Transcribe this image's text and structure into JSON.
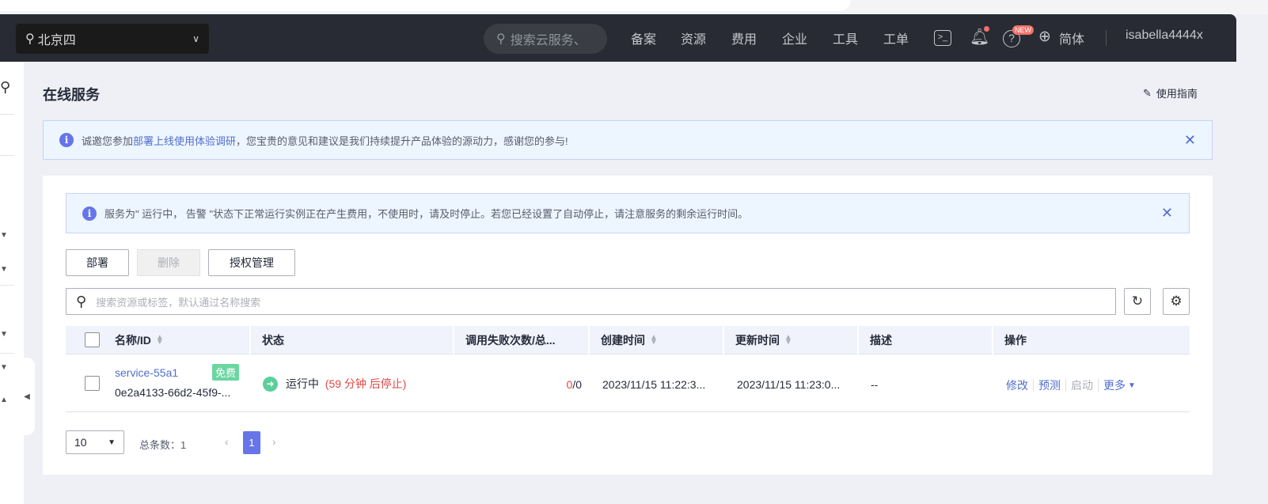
{
  "header": {
    "region": "北京四",
    "search_placeholder": "搜索云服务、",
    "nav": [
      "备案",
      "资源",
      "费用",
      "企业",
      "工具",
      "工单"
    ],
    "new_badge": "NEW",
    "language": "简体",
    "user": "isabella4444x"
  },
  "page": {
    "title": "在线服务",
    "guide": "使用指南"
  },
  "survey_banner": {
    "prefix": "诚邀您参加",
    "link": "部署上线使用体验调研",
    "suffix": "，您宝贵的意见和建议是我们持续提升产品体验的源动力，感谢您的参与!"
  },
  "warning_banner": {
    "text": "服务为\" 运行中， 告警 \"状态下正常运行实例正在产生费用，不使用时，请及时停止。若您已经设置了自动停止，请注意服务的剩余运行时间。"
  },
  "toolbar": {
    "deploy": "部署",
    "delete": "删除",
    "auth": "授权管理",
    "search_placeholder": "搜索资源或标签，默认通过名称搜索"
  },
  "table": {
    "columns": [
      "名称/ID",
      "状态",
      "调用失败次数/总...",
      "创建时间",
      "更新时间",
      "描述",
      "操作"
    ],
    "rows": [
      {
        "name": "service-55a1",
        "badge": "免费",
        "id": "0e2a4133-66d2-45f9-...",
        "status": "运行中",
        "status_note": "(59 分钟 后停止)",
        "fail": "0",
        "total": "/0",
        "created": "2023/11/15 11:22:3...",
        "updated": "2023/11/15 11:23:0...",
        "desc": "--",
        "actions": [
          "修改",
          "预测",
          "启动",
          "更多"
        ]
      }
    ]
  },
  "pagination": {
    "page_size": "10",
    "total_label": "总条数：1",
    "current_page": "1"
  }
}
